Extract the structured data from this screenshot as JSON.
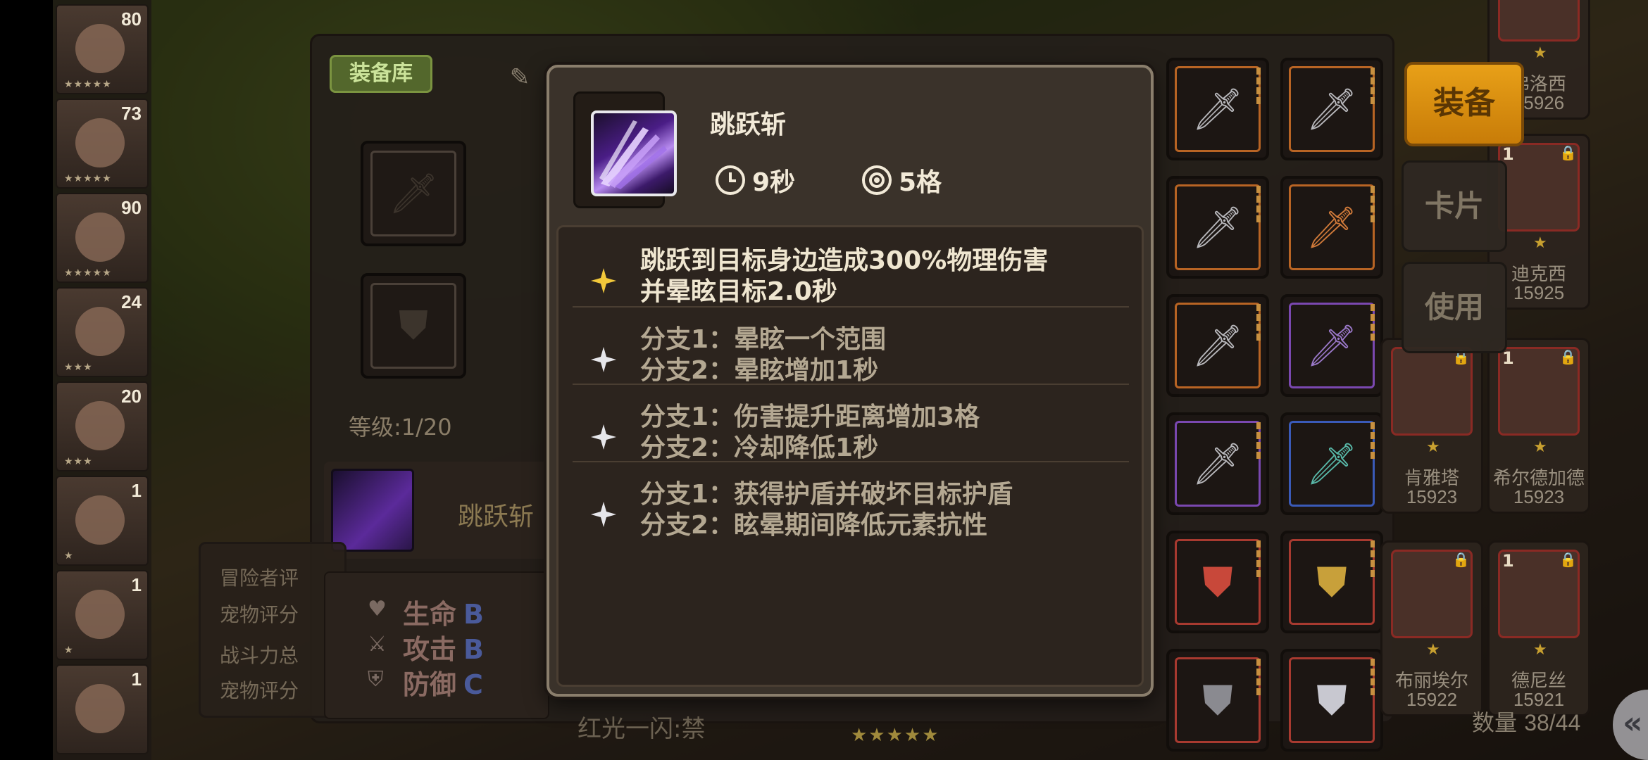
{
  "heroes": [
    {
      "level": "80"
    },
    {
      "level": "73"
    },
    {
      "level": "90"
    },
    {
      "level": "24"
    },
    {
      "level": "20"
    },
    {
      "level": "1"
    },
    {
      "level": "1"
    },
    {
      "level": "1"
    }
  ],
  "equipment_panel": {
    "tab_label": "装备库",
    "level_text": "等级:1/20",
    "skill_name": "跳跃斩",
    "eval_lines": [
      "冒险者评",
      "宠物评分",
      "战斗力总",
      "宠物评分"
    ],
    "stats": [
      {
        "label": "生命",
        "grade": "B"
      },
      {
        "label": "攻击",
        "grade": "B"
      },
      {
        "label": "防御",
        "grade": "C"
      }
    ],
    "bottom_text": "红光一闪:禁"
  },
  "buttons": {
    "equip": "装备",
    "cards": "卡片",
    "use": "使用"
  },
  "companions": [
    {
      "name": "弗洛西",
      "score": "15926"
    },
    {
      "name": "迪克西",
      "score": "15925",
      "num": "1"
    },
    {
      "name": "希尔德加德",
      "score": "15923",
      "num": "1"
    },
    {
      "name": "肯雅塔",
      "score": "15923"
    },
    {
      "name": "德尼丝",
      "score": "15921",
      "num": "1"
    },
    {
      "name": "布丽埃尔",
      "score": "15922"
    }
  ],
  "count": {
    "label": "数量",
    "value": "38/44"
  },
  "tooltip": {
    "title": "跳跃斩",
    "cooldown": "9秒",
    "range": "5格",
    "sections": [
      {
        "lines": [
          "跳跃到目标身边造成300%物理伤害",
          "并晕眩目标2.0秒"
        ],
        "star": "gold"
      },
      {
        "lines": [
          "分支1：晕眩一个范围",
          "分支2：晕眩增加1秒"
        ],
        "star": "silver"
      },
      {
        "lines": [
          "分支1：伤害提升距离增加3格",
          "分支2：冷却降低1秒"
        ],
        "star": "silver"
      },
      {
        "lines": [
          "分支1：获得护盾并破坏目标护盾",
          "分支2：眩晕期间降低元素抗性"
        ],
        "star": "silver"
      }
    ]
  },
  "colors": {
    "accent_gold": "#e8a018",
    "tooltip_border": "#8a7e6c",
    "panel_green": "#53672c",
    "spark_gold": "#f2c83a",
    "spark_silver": "#e6e6ea"
  }
}
